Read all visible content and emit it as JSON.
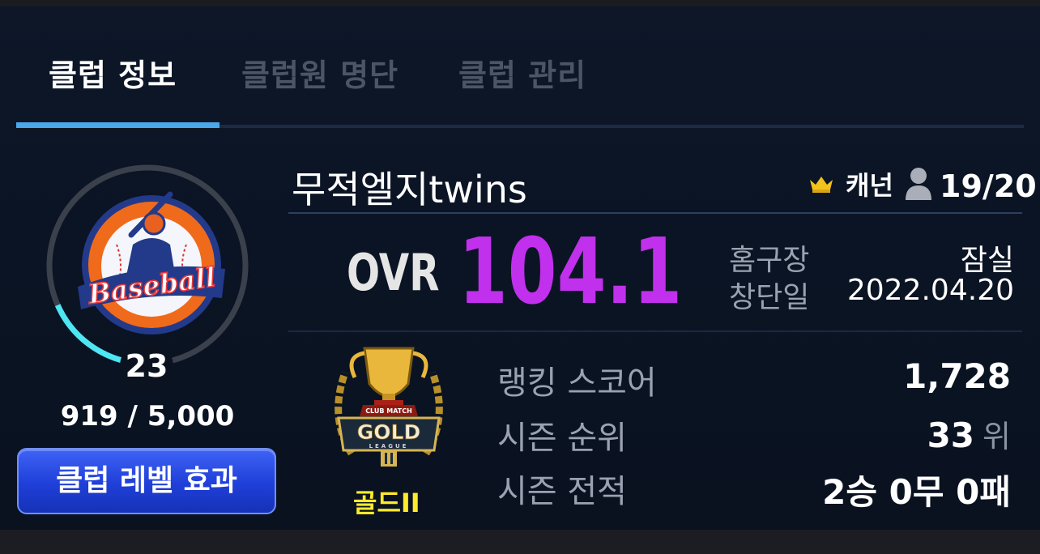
{
  "tabs": [
    {
      "label": "클럽 정보",
      "active": true
    },
    {
      "label": "클럽원 명단",
      "active": false
    },
    {
      "label": "클럽 관리",
      "active": false
    }
  ],
  "club": {
    "logo_text": "Baseball",
    "level": "23",
    "xp_current": "919",
    "xp_max": "5,000",
    "xp_text": "919 / 5,000",
    "xp_progress": 0.184,
    "level_effect_button": "클럽 레벨 효과",
    "name": "무적엘지twins",
    "captain": "캐넌",
    "members": "19/20"
  },
  "ovr": {
    "label": "OVR",
    "value": "104.1"
  },
  "info": {
    "stadium_label": "홈구장",
    "stadium_value": "잠실",
    "founded_label": "창단일",
    "founded_value": "2022.04.20"
  },
  "league": {
    "badge_top_text": "CLUB MATCH",
    "badge_main_text": "GOLD",
    "badge_sub_text": "LEAGUE",
    "name": "골드II"
  },
  "stats": {
    "ranking_score_label": "랭킹 스코어",
    "ranking_score_value": "1,728",
    "season_rank_label": "시즌 순위",
    "season_rank_value": "33",
    "season_rank_unit": "위",
    "season_record_label": "시즌 전적",
    "season_record_value": "2승 0무 0패"
  },
  "colors": {
    "accent_tab": "#4ba6ea",
    "ovr": "#c130ec",
    "league_gold": "#ffea2b",
    "button_blue": "#2a4ae6",
    "xp_ring": "#4de6f2"
  },
  "icons": {
    "captain": "crown-icon",
    "members": "person-icon"
  }
}
